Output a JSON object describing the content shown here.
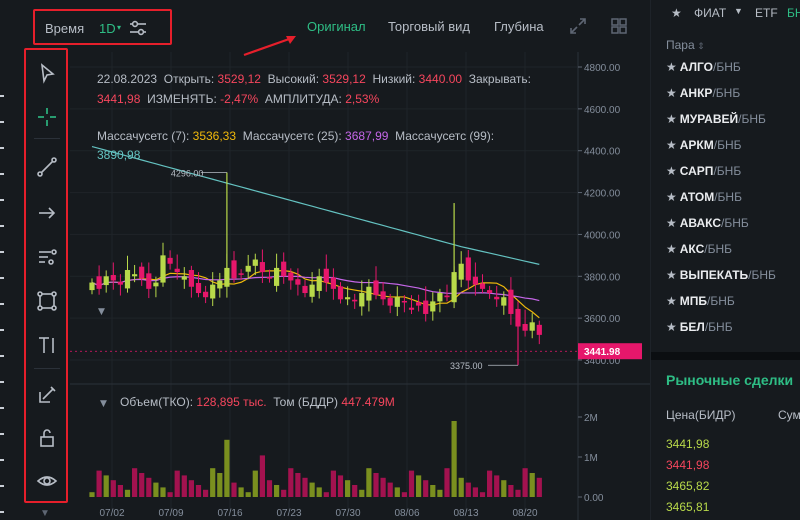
{
  "toolbar_top": {
    "time_label": "Время",
    "interval": "1D",
    "interval_caret": "▾",
    "tabs": [
      "Оригинал",
      "Торговый вид",
      "Глубина"
    ],
    "active_tab": "Оригинал"
  },
  "ohlc": {
    "date": "22.08.2023",
    "open_label": "Открыть:",
    "open": "3529,12",
    "high_label": "Высокий:",
    "high": "3529,12",
    "low_label": "Низкий:",
    "low": "3440.00",
    "close_label": "Закрывать:",
    "close": "3441,98",
    "change_label": "ИЗМЕНЯТЬ:",
    "change": "-2,47%",
    "amp_label": "АМПЛИТУДА:",
    "amp": "2,53%"
  },
  "ma": {
    "ma7_label": "Массачусетс (7):",
    "ma7": "3536,33",
    "ma25_label": "Массачусетс (25):",
    "ma25": "3687,99",
    "ma99_label": "Массачусетс (99):",
    "ma99": "3890,98"
  },
  "volume": {
    "label": "Объем(ТКО):",
    "value1": "128,895 тыс.",
    "label2": "Том (БДДР)",
    "value2": "447.479M"
  },
  "price_axis": [
    "4800.00",
    "4600.00",
    "4400.00",
    "4200.00",
    "4000.00",
    "3800.00",
    "3600.00",
    "3400.00"
  ],
  "volume_axis": [
    "2M",
    "1M",
    "0.00"
  ],
  "x_axis": [
    "07/02",
    "07/09",
    "07/16",
    "07/23",
    "07/30",
    "08/06",
    "08/13",
    "08/20"
  ],
  "annotations": {
    "high_marker": "4296.00",
    "low_marker": "3375.00",
    "last_price": "3441.98"
  },
  "colors": {
    "up": "#b8d94a",
    "down": "#e6176b",
    "accent": "#2ebd85",
    "highlight_box": "#e61f2b"
  },
  "right_panel": {
    "tabs_visible": [
      "ФИАТ",
      "ETF",
      "БН"
    ],
    "pair_header": "Пара",
    "pairs": [
      {
        "base": "АЛГО",
        "quote": "/БНБ"
      },
      {
        "base": "АНКР",
        "quote": "/БНБ"
      },
      {
        "base": "МУРАВЕЙ",
        "quote": "/БНБ"
      },
      {
        "base": "АРКМ",
        "quote": "/БНБ"
      },
      {
        "base": "САРП",
        "quote": "/БНБ"
      },
      {
        "base": "АТОМ",
        "quote": "/БНБ"
      },
      {
        "base": "АВАКС",
        "quote": "/БНБ"
      },
      {
        "base": "АКС",
        "quote": "/БНБ"
      },
      {
        "base": "ВЫПЕКАТЬ",
        "quote": "/БНБ"
      },
      {
        "base": "МПБ",
        "quote": "/БНБ"
      },
      {
        "base": "БЕЛ",
        "quote": "/БНБ"
      }
    ],
    "market_trades_title": "Рыночные сделки",
    "price_col": "Цена(БИДР)",
    "sum_col": "Сум",
    "trades": [
      {
        "price": "3441,98",
        "dir": "up"
      },
      {
        "price": "3441,98",
        "dir": "dn"
      },
      {
        "price": "3465,82",
        "dir": "up"
      },
      {
        "price": "3465,81",
        "dir": "up"
      }
    ]
  }
}
